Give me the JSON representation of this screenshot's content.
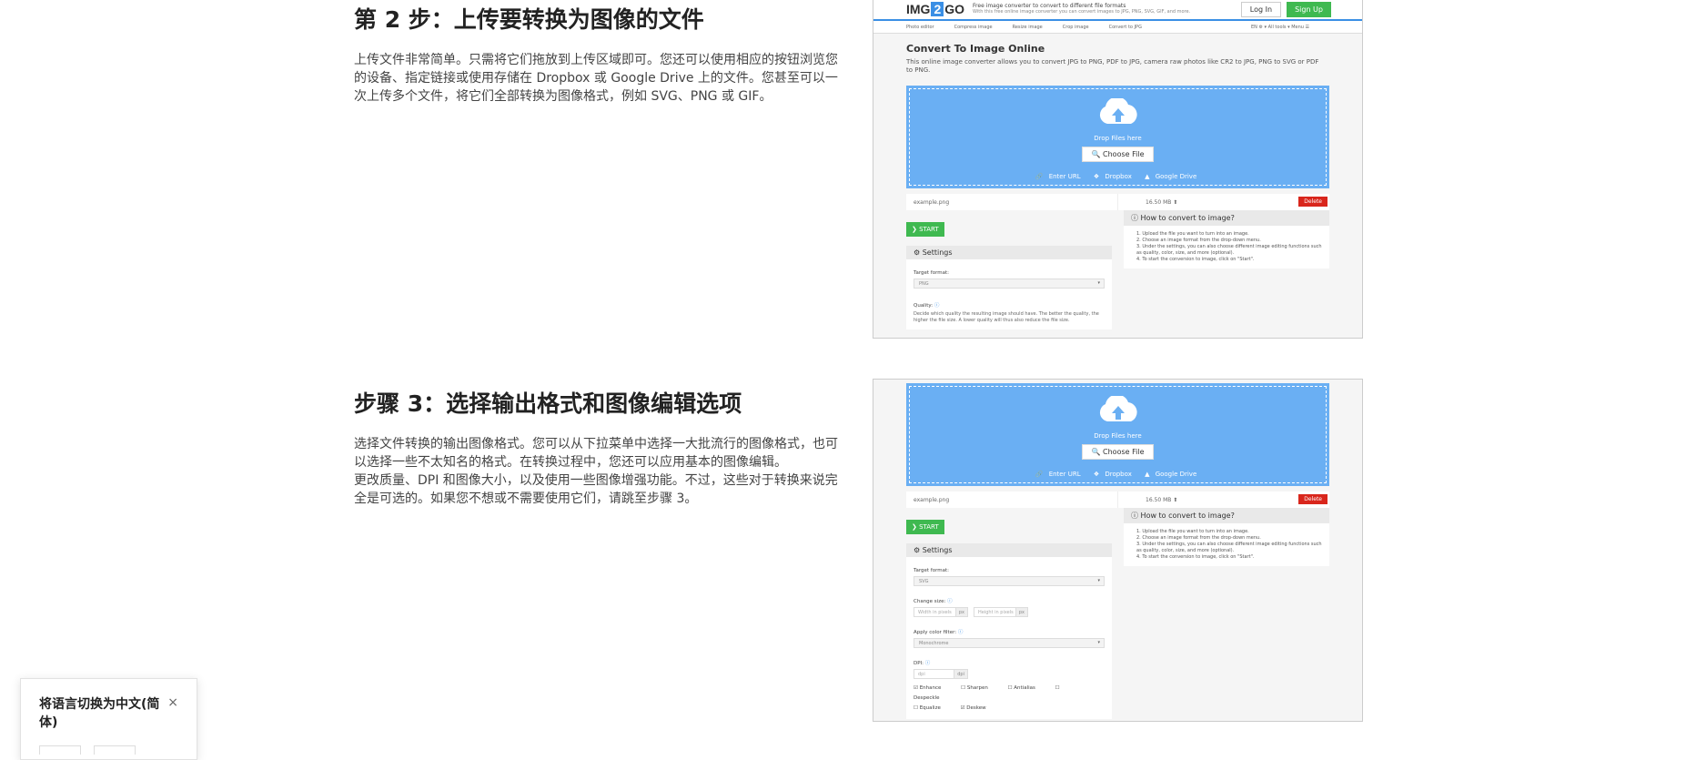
{
  "step2": {
    "title": "第 2 步：上传要转换为图像的文件",
    "para": "上传文件非常简单。只需将它们拖放到上传区域即可。您还可以使用相应的按钮浏览您的设备、指定链接或使用存储在 Dropbox 或 Google Drive 上的文件。您甚至可以一次上传多个文件，将它们全部转换为图像格式，例如 SVG、PNG 或 GIF。"
  },
  "step3": {
    "title": "步骤 3：选择输出格式和图像编辑选项",
    "para1": "选择文件转换的输出图像格式。您可以从下拉菜单中选择一大批流行的图像格式，也可以选择一些不太知名的格式。在转换过程中，您还可以应用基本的图像编辑。",
    "para2": "更改质量、DPI 和图像大小，以及使用一些图像增强功能。不过，这些对于转换来说完全是可选的。如果您不想或不需要使用它们，请跳至步骤 3。"
  },
  "shot": {
    "logo_a": "IMG",
    "logo_b": "2",
    "logo_c": "GO",
    "tagline": "Free image converter to convert to different file formats",
    "tagline_small": "With this free online image converter you can convert images to JPG, PNG, SVG, GIF, and more.",
    "login": "Log In",
    "signup": "Sign Up",
    "nav": [
      "Photo editor",
      "Compress image",
      "Resize image",
      "Crop image",
      "Convert to JPG"
    ],
    "nav_right": "EN ⚙ ▾   All tools ▾   Menu ☰",
    "page_title": "Convert To Image Online",
    "page_desc": "This online image converter allows you to convert JPG to PNG, PDF to JPG, camera raw photos like CR2 to JPG, PNG to SVG or PDF to PNG.",
    "drop_text": "Drop Files here",
    "choose_file": "Choose File",
    "src_url": "Enter URL",
    "src_dropbox": "Dropbox",
    "src_gdrive": "Google Drive",
    "file_name": "example.png",
    "file_size": "16.50 MB",
    "delete": "Delete",
    "start": "START",
    "settings": "Settings",
    "target_format": "Target format:",
    "format_png": "PNG",
    "format_svg": "SVG",
    "quality": "Quality:",
    "quality_desc": "Decide which quality the resulting image should have. The better the quality, the higher the file size. A lower quality will thus also reduce the file size.",
    "change_size": "Change size:",
    "width_ph": "Width in pixels",
    "height_ph": "Height in pixels",
    "px": "px",
    "color_filter": "Apply color filter:",
    "filter_value": "Monochrome",
    "dpi": "DPI:",
    "dpi_ph": "dpi",
    "dpi_unit": "dpi",
    "checks1": [
      "Enhance",
      "Sharpen",
      "Antialias",
      "Despeckle"
    ],
    "checks2": [
      "Equalize",
      "Deskew"
    ],
    "how_title": "How to convert to image?",
    "how_steps": [
      "1. Upload the file you want to turn into an image.",
      "2. Choose an image format from the drop-down menu.",
      "3. Under the settings, you can also choose different image editing functions such as quality, color, size, and more (optional).",
      "4. To start the conversion to image, click on \"Start\"."
    ]
  },
  "toast": {
    "message": "将语言切换为中文(简体)",
    "close": "×"
  }
}
